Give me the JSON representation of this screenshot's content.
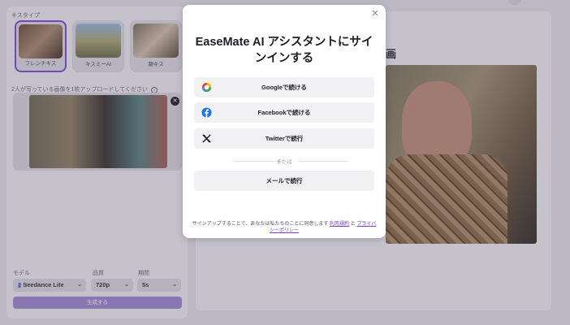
{
  "left": {
    "kiss_type_label": "キスタイプ",
    "kiss_types": [
      {
        "label": "フレンチキス",
        "selected": true
      },
      {
        "label": "キスミーAI",
        "selected": false
      },
      {
        "label": "頬キス",
        "selected": false
      }
    ],
    "upload_label": "2人が写っている画像を1枚アップロードしてください",
    "model_label": "モデル",
    "model_value": "Seedance Lite",
    "quality_label": "品質",
    "quality_value": "720p",
    "duration_label": "期間",
    "duration_value": "5s",
    "generate_label": "生成する"
  },
  "right": {
    "title_fragment": "画"
  },
  "modal": {
    "title": "EaseMate AI アシスタントにサインインする",
    "google_label": "Googleで続ける",
    "facebook_label": "Facebookで続ける",
    "twitter_label": "Twitterで続行",
    "divider_text": "または",
    "email_label": "メールで続行",
    "legal_prefix": "サインアップすることで、あなたは私たちのことに同意します",
    "terms_link": "利用規約",
    "legal_and": "と",
    "privacy_link": "プライバシーポリシー"
  },
  "colors": {
    "accent": "#7c3cd8",
    "google_red": "#ea4335",
    "facebook_blue": "#1877f2"
  }
}
